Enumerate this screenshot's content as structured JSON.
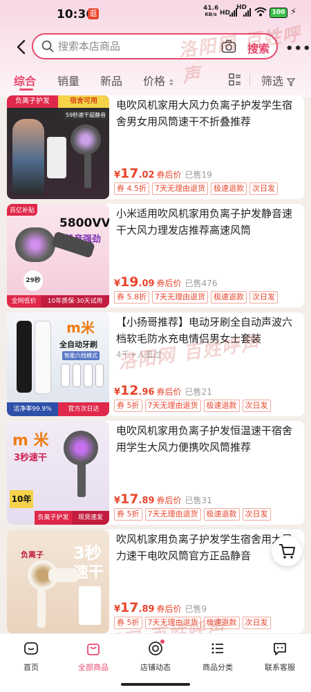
{
  "status_bar": {
    "time": "10:36",
    "app_badge": "逛",
    "net_speed": "41.6",
    "net_unit": "KB/s",
    "sig1": "HD",
    "sig2": "HD",
    "battery": "100"
  },
  "search": {
    "placeholder": "搜索本店商品",
    "button": "搜索"
  },
  "tabs": [
    {
      "label": "综合"
    },
    {
      "label": "销量"
    },
    {
      "label": "新品"
    },
    {
      "label": "价格"
    }
  ],
  "filter_label": "筛选",
  "products": [
    {
      "title": "电吹风机家用大风力负离子护发学生宿舍男女用风筒速干不折叠推荐",
      "price_symbol": "¥",
      "price_int": "17",
      "price_dec": ".02",
      "price_note": "券后价",
      "sold": "已售19",
      "extra": "",
      "tags": [
        "券 4.5折",
        "7天无理由退货",
        "极速退款",
        "次日发"
      ],
      "thumb": {
        "top_left": "负离子护发",
        "top_right": "宿舍可用",
        "headline": "59秒速干超静音"
      }
    },
    {
      "title": "小米适用吹风机家用负离子护发静音速干大风力理发店推荐高速风筒",
      "price_symbol": "¥",
      "price_int": "19",
      "price_dec": ".09",
      "price_note": "券后价",
      "sold": "已售476",
      "extra": "",
      "tags": [
        "券 5.8折",
        "7天无理由退货",
        "极速退款",
        "次日发"
      ],
      "thumb": {
        "corner": "百亿补贴",
        "headline": "5800VV",
        "sub": "静音强劲",
        "badge": "29秒",
        "footer_left": "全网低价",
        "footer_right": "10年质保·30天试用"
      }
    },
    {
      "title": "【小扬哥推荐】电动牙刷全自动声波六档软毛防水充电情侣男女士套装",
      "price_symbol": "¥",
      "price_int": "12",
      "price_dec": ".96",
      "price_note": "券后价",
      "sold": "已售21",
      "extra": "4千+人逛过",
      "tags": [
        "券 5折",
        "7天无理由退货",
        "极速退款",
        "次日发"
      ],
      "thumb": {
        "brand": "m米",
        "headline": "全自动牙刷",
        "sub": "智能六档模式",
        "footer_left": "洁净率99.9%",
        "footer_right": "官方次日达"
      }
    },
    {
      "title": "电吹风机家用负离子护发恒温速干宿舍用学生大风力便携吹风筒推荐",
      "price_symbol": "¥",
      "price_int": "17",
      "price_dec": ".89",
      "price_note": "券后价",
      "sold": "已售31",
      "extra": "",
      "tags": [
        "券 5折",
        "7天无理由退货",
        "极速退款",
        "次日发"
      ],
      "thumb": {
        "brand": "m 米",
        "headline": "3秒速干",
        "badge": "10年",
        "footer_left": "负离子护发",
        "footer_right": "现货速发"
      }
    },
    {
      "title": "吹风机家用负离子护发学生宿舍用大风力速干电吹风筒官方正品静音",
      "price_symbol": "¥",
      "price_int": "17",
      "price_dec": ".89",
      "price_note": "券后价",
      "sold": "已售9",
      "extra": "",
      "tags": [
        "券 5折",
        "7天无理由退货",
        "极速退款",
        "次日发"
      ],
      "thumb": {
        "headline": "3秒",
        "sub": "速干",
        "side": "负离子"
      }
    }
  ],
  "bottom_nav": [
    {
      "label": "首页"
    },
    {
      "label": "全部商品"
    },
    {
      "label": "店铺动态"
    },
    {
      "label": "商品分类"
    },
    {
      "label": "联系客服"
    }
  ],
  "watermark": "洛阳网 百姓呼声"
}
